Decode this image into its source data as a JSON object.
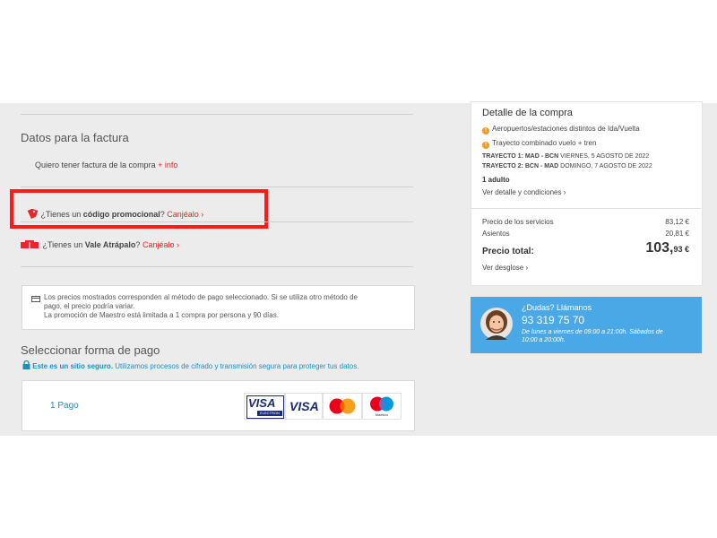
{
  "invoice": {
    "title": "Datos para la factura",
    "want_invoice": "Quiero tener factura de la compra",
    "info_link": "+ info"
  },
  "promo": {
    "prefix": "¿Tienes un ",
    "bold": "código promocional",
    "suffix": "?",
    "link": "Canjéalo ›"
  },
  "vale": {
    "prefix": "¿Tienes un ",
    "bold": "Vale Atrápalo",
    "suffix": "?",
    "link": "Canjéalo ›"
  },
  "notice": {
    "line1": "Los precios mostrados corresponden al método de pago seleccionado. Si se utiliza otro método de",
    "line2": "pago, el precio podría variar.",
    "line3": "La promoción de Maestro está limitada a 1 compra por persona y 90 días."
  },
  "payment": {
    "title": "Seleccionar forma de pago",
    "secure_bold": "Este es un sitio seguro.",
    "secure_rest": "Utilizamos procesos de cifrado y transmisión segura para proteger tus datos.",
    "option_label": "1 Pago",
    "logos": {
      "visa_electron": "VISA",
      "visa_electron_sub": "ELECTRON",
      "visa": "VISA",
      "maestro_sub": "Maestro"
    }
  },
  "summary": {
    "title": "Detalle de la compra",
    "note1": "Aeropuertos/estaciones distintos de Ida/Vuelta",
    "note2": "Trayecto combinado vuelo + tren",
    "route1_label": "TRAYECTO 1: MAD - BCN",
    "route1_date": "VIERNES, 5 AGOSTO DE 2022",
    "route2_label": "TRAYECTO 2: BCN - MAD",
    "route2_date": "DOMINGO, 7 AGOSTO DE 2022",
    "adults": "1 adulto",
    "details_link": "Ver detalle y condiciones ›",
    "services_label": "Precio de los servicios",
    "services_value": "83,12 €",
    "seats_label": "Asientos",
    "seats_value": "20,81 €",
    "total_label": "Precio total:",
    "total_int": "103,",
    "total_dec": "93 €",
    "breakdown_link": "Ver desglose ›"
  },
  "help": {
    "title": "¿Dudas? Llámanos",
    "phone": "93 319 75 70",
    "hours": "De lunes a viernes de 09:00 a 21:00h. Sábados de",
    "hours2": "10:00 a 20:00h."
  },
  "colors": {
    "accent": "#e8262e",
    "link_blue": "#1f8ebf",
    "help_bg": "#4aa8e6",
    "highlight": "#ff1a1a"
  }
}
